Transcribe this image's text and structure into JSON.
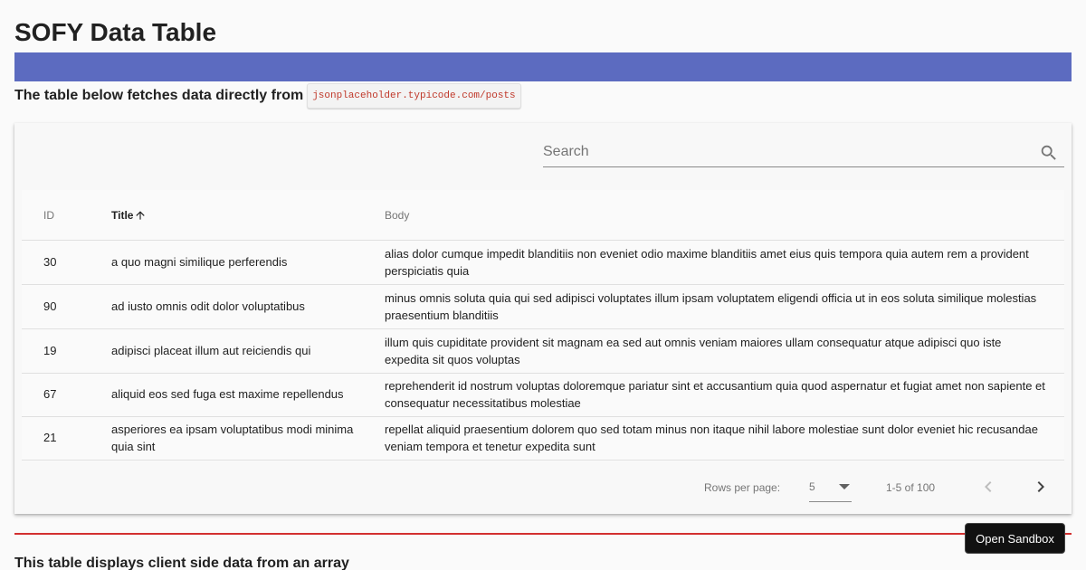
{
  "page": {
    "title": "SOFY Data Table",
    "intro_text": "The table below fetches data directly from",
    "intro_code": "jsonplaceholder.typicode.com/posts",
    "second_heading": "This table displays client side data from an array",
    "banner_color": "#5c6bc0",
    "divider_color": "#d32f2f"
  },
  "search": {
    "placeholder": "Search",
    "value": "",
    "icon": "search-icon"
  },
  "table": {
    "columns": [
      {
        "label": "ID",
        "sorted": false
      },
      {
        "label": "Title",
        "sorted": true,
        "sort_direction": "ascending",
        "sort_icon": "arrow-up-icon"
      },
      {
        "label": "Body",
        "sorted": false
      }
    ],
    "rows": [
      {
        "id": "30",
        "title": "a quo magni similique perferendis",
        "body": "alias dolor cumque impedit blanditiis non eveniet odio maxime blanditiis amet eius quis tempora quia autem rem a provident perspiciatis quia"
      },
      {
        "id": "90",
        "title": "ad iusto omnis odit dolor voluptatibus",
        "body": "minus omnis soluta quia qui sed adipisci voluptates illum ipsam voluptatem eligendi officia ut in eos soluta similique molestias praesentium blanditiis"
      },
      {
        "id": "19",
        "title": "adipisci placeat illum aut reiciendis qui",
        "body": "illum quis cupiditate provident sit magnam ea sed aut omnis veniam maiores ullam consequatur atque adipisci quo iste expedita sit quos voluptas"
      },
      {
        "id": "67",
        "title": "aliquid eos sed fuga est maxime repellendus",
        "body": "reprehenderit id nostrum voluptas doloremque pariatur sint et accusantium quia quod aspernatur et fugiat amet non sapiente et consequatur necessitatibus molestiae"
      },
      {
        "id": "21",
        "title": "asperiores ea ipsam voluptatibus modi minima quia sint",
        "body": "repellat aliquid praesentium dolorem quo sed totam minus non itaque nihil labore molestiae sunt dolor eveniet hic recusandae veniam tempora et tenetur expedita sunt"
      }
    ]
  },
  "pagination": {
    "rows_per_page_label": "Rows per page:",
    "rows_per_page_value": "5",
    "range_text": "1-5 of 100",
    "prev_icon": "chevron-left-icon",
    "next_icon": "chevron-right-icon",
    "prev_enabled": false,
    "next_enabled": true
  },
  "sandbox_button": {
    "label": "Open Sandbox"
  }
}
